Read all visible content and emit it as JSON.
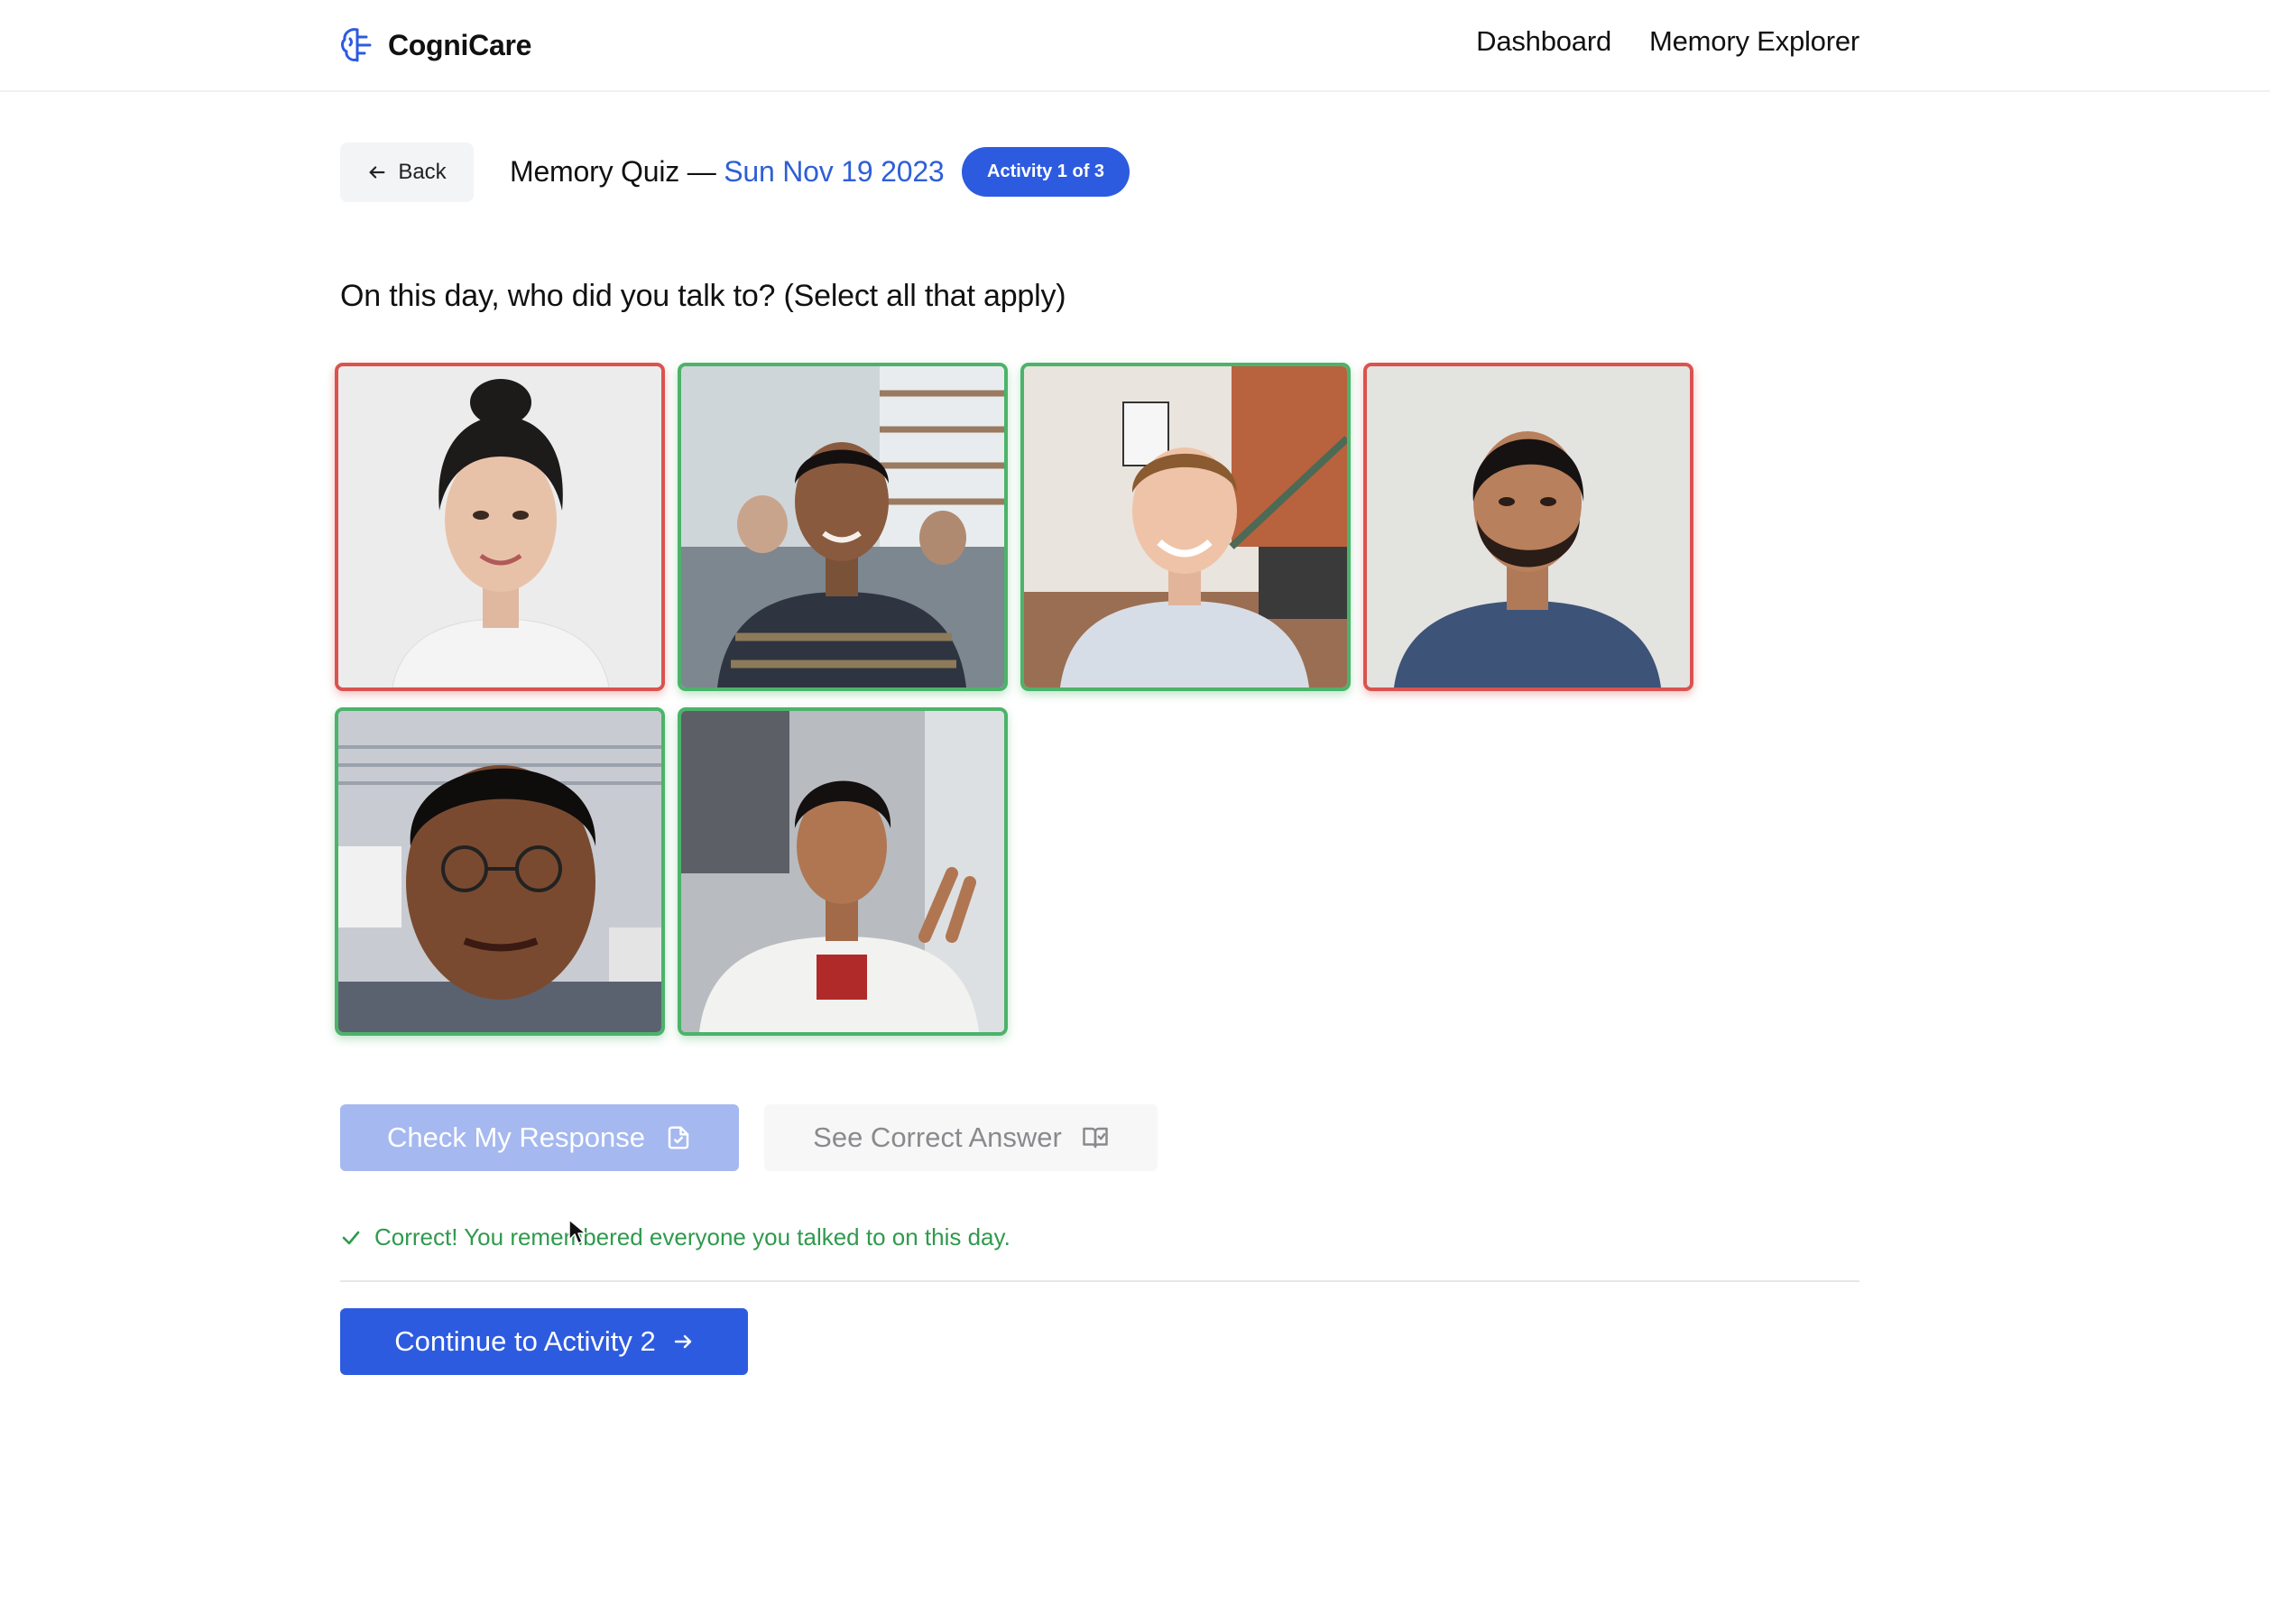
{
  "brand": {
    "name": "CogniCare",
    "logo_icon": "brain-icon"
  },
  "nav": {
    "links": [
      "Dashboard",
      "Memory Explorer"
    ]
  },
  "header": {
    "back_label": "Back",
    "quiz_title": "Memory Quiz — ",
    "quiz_date": "Sun Nov 19 2023",
    "activity_badge": "Activity 1 of 3"
  },
  "question": "On this day, who did you talk to? (Select all that apply)",
  "photos": [
    {
      "status": "incorrect",
      "border_color": "#d9534f"
    },
    {
      "status": "correct",
      "border_color": "#4cb36a"
    },
    {
      "status": "correct",
      "border_color": "#4cb36a"
    },
    {
      "status": "incorrect",
      "border_color": "#d9534f"
    },
    {
      "status": "correct",
      "border_color": "#4cb36a"
    },
    {
      "status": "correct",
      "border_color": "#4cb36a"
    }
  ],
  "actions": {
    "check_label": "Check My Response",
    "check_icon": "file-check-icon",
    "see_label": "See Correct Answer",
    "see_icon": "open-book-icon"
  },
  "feedback": {
    "text": "Correct! You remembered everyone you talked to on this day.",
    "color": "#2f9a4d"
  },
  "continue": {
    "label": "Continue to Activity 2",
    "icon": "arrow-right-icon"
  },
  "colors": {
    "accent": "#2d5be0",
    "date": "#2f5fd6",
    "correct": "#4cb36a",
    "incorrect": "#d9534f"
  }
}
